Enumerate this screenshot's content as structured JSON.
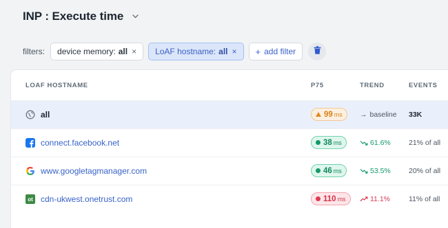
{
  "header": {
    "title": "INP : Execute time"
  },
  "filters": {
    "label": "filters:",
    "chips": [
      {
        "key": "device memory:",
        "value": "all"
      },
      {
        "key": "LoAF hostname:",
        "value": "all"
      }
    ],
    "remove_glyph": "×",
    "add_label": "add filter",
    "add_glyph": "+"
  },
  "table": {
    "columns": {
      "host": "LOAF HOSTNAME",
      "p75": "P75",
      "trend": "TREND",
      "events": "EVENTS"
    },
    "rows": [
      {
        "host": "all",
        "icon": "globe-icon",
        "p75": "99",
        "unit": "ms",
        "status": "warn",
        "trend": "baseline",
        "trend_glyph": "→",
        "events": "33K"
      },
      {
        "host": "connect.facebook.net",
        "icon": "facebook-icon",
        "p75": "38",
        "unit": "ms",
        "status": "good",
        "trend": "61.6%",
        "events": "21% of all"
      },
      {
        "host": "www.googletagmanager.com",
        "icon": "google-icon",
        "p75": "46",
        "unit": "ms",
        "status": "good",
        "trend": "53.5%",
        "events": "20% of all"
      },
      {
        "host": "cdn-ukwest.onetrust.com",
        "icon": "onetrust-icon",
        "icon_text": "ot",
        "p75": "110",
        "unit": "ms",
        "status": "bad",
        "trend": "11.1%",
        "events": "11% of all"
      }
    ]
  },
  "colors": {
    "accent": "#3763c8",
    "good": "#118a5d",
    "warn": "#d9821c",
    "bad": "#d33248"
  }
}
